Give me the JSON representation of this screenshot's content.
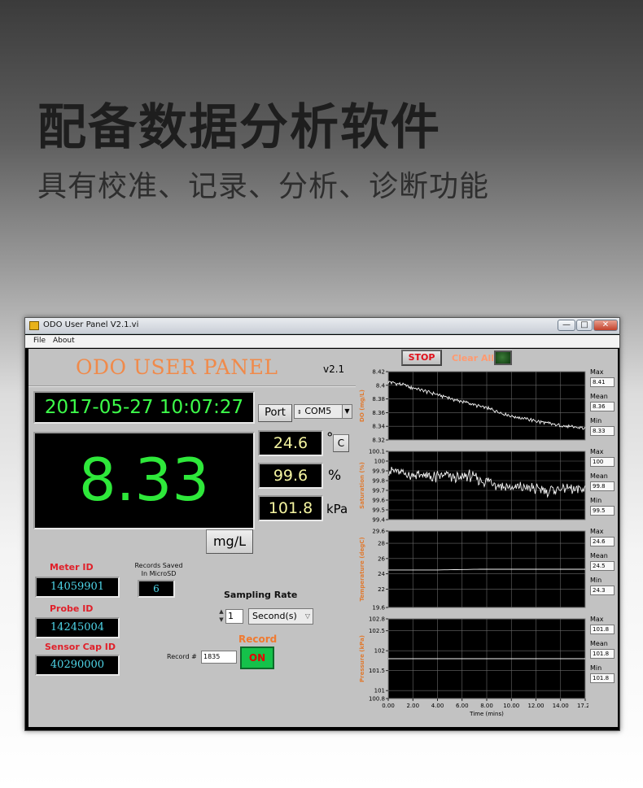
{
  "page": {
    "headline": "配备数据分析软件",
    "subline": "具有校准、记录、分析、诊断功能"
  },
  "window": {
    "title": "ODO User Panel V2.1.vi",
    "controls": {
      "minimize": "—",
      "maximize": "□",
      "close": "✕"
    },
    "menu": [
      "File",
      "About"
    ],
    "icon": "labview-app-icon"
  },
  "panel": {
    "title": "ODO USER PANEL",
    "version": "v2.1",
    "datetime": "2017-05-27 10:07:27",
    "main_value": "8.33",
    "main_unit_button": "mg/L",
    "port_label": "Port",
    "port_value": "COM5",
    "temperature": {
      "value": "24.6",
      "unit_symbol": "°",
      "unit_button": "C"
    },
    "saturation": {
      "value": "99.6",
      "unit": "%"
    },
    "pressure": {
      "value": "101.8",
      "unit": "kPa"
    },
    "meter_id": {
      "label": "Meter ID",
      "value": "14059901"
    },
    "probe_id": {
      "label": "Probe ID",
      "value": "14245004"
    },
    "sensor_cap_id": {
      "label": "Sensor Cap ID",
      "value": "40290000"
    },
    "records_saved": {
      "label_line1": "Records Saved",
      "label_line2": "In MicroSD",
      "value": "6"
    },
    "sampling_rate": {
      "label": "Sampling Rate",
      "value": "1",
      "unit": "Second(s)"
    },
    "record": {
      "label": "Record",
      "number_label": "Record #",
      "number_value": "1835",
      "toggle_label": "ON"
    }
  },
  "right": {
    "stop_label": "STOP",
    "clear_all_label": "Clear All"
  },
  "colors": {
    "lcd_green": "#2ee83a",
    "title_orange": "#f08a4a",
    "red_label": "#e0202a",
    "id_cyan": "#4fd7ea",
    "axis_orange": "#e07a30",
    "on_green": "#15c24a"
  },
  "chart_data": [
    {
      "type": "line",
      "ylabel": "DO (mg/L)",
      "yticks": [
        "8.42",
        "8.4",
        "8.38",
        "8.36",
        "8.34",
        "8.32"
      ],
      "ylim": [
        8.32,
        8.42
      ],
      "xlim": [
        0,
        17.2
      ],
      "grid": true,
      "series": [
        {
          "x": [
            0,
            1,
            2,
            3,
            4,
            5,
            6,
            7,
            8,
            9,
            10,
            11,
            12,
            13,
            14,
            15,
            16,
            17.2
          ],
          "values": [
            8.405,
            8.402,
            8.397,
            8.392,
            8.388,
            8.383,
            8.378,
            8.374,
            8.369,
            8.365,
            8.359,
            8.354,
            8.351,
            8.347,
            8.344,
            8.341,
            8.339,
            8.337
          ]
        }
      ],
      "stats": [
        {
          "label": "Max",
          "value": "8.41"
        },
        {
          "label": "Mean",
          "value": "8.36"
        },
        {
          "label": "Min",
          "value": "8.33"
        }
      ]
    },
    {
      "type": "line",
      "ylabel": "Saturation (%)",
      "yticks": [
        "100.1",
        "100",
        "99.9",
        "99.8",
        "99.7",
        "99.6",
        "99.5",
        "99.4"
      ],
      "ylim": [
        99.4,
        100.1
      ],
      "xlim": [
        0,
        17.2
      ],
      "grid": true,
      "series": [
        {
          "x": [
            0,
            1,
            2,
            3,
            4,
            5,
            6,
            7,
            8,
            9,
            10,
            11,
            12,
            13,
            14,
            15,
            16,
            17.2
          ],
          "values": [
            99.91,
            99.88,
            99.86,
            99.85,
            99.83,
            99.86,
            99.82,
            99.85,
            99.81,
            99.78,
            99.74,
            99.72,
            99.73,
            99.71,
            99.7,
            99.72,
            99.71,
            99.72
          ]
        }
      ],
      "stats": [
        {
          "label": "Max",
          "value": "100"
        },
        {
          "label": "Mean",
          "value": "99.8"
        },
        {
          "label": "Min",
          "value": "99.5"
        }
      ]
    },
    {
      "type": "line",
      "ylabel": "Temperature (degC)",
      "yticks": [
        "29.6",
        "28",
        "26",
        "24",
        "22",
        "19.6"
      ],
      "ylim": [
        19.6,
        29.6
      ],
      "xlim": [
        0,
        17.2
      ],
      "grid": true,
      "series": [
        {
          "x": [
            0,
            4,
            8,
            12,
            17.2
          ],
          "values": [
            24.5,
            24.5,
            24.6,
            24.6,
            24.6
          ]
        }
      ],
      "stats": [
        {
          "label": "Max",
          "value": "24.6"
        },
        {
          "label": "Mean",
          "value": "24.5"
        },
        {
          "label": "Min",
          "value": "24.3"
        }
      ]
    },
    {
      "type": "line",
      "ylabel": "Pressure (kPa)",
      "xlabel": "Time (mins)",
      "yticks": [
        "102.8",
        "102.5",
        "102",
        "101.5",
        "101",
        "100.8"
      ],
      "ylim": [
        100.8,
        102.8
      ],
      "xticks": [
        "0.00",
        "2.00",
        "4.00",
        "6.00",
        "8.00",
        "10.00",
        "12.00",
        "14.00",
        "17.21"
      ],
      "xlim": [
        0,
        17.21
      ],
      "grid": true,
      "series": [
        {
          "x": [
            0,
            17.21
          ],
          "values": [
            101.8,
            101.8
          ]
        }
      ],
      "stats": [
        {
          "label": "Max",
          "value": "101.8"
        },
        {
          "label": "Mean",
          "value": "101.8"
        },
        {
          "label": "Min",
          "value": "101.8"
        }
      ]
    }
  ]
}
